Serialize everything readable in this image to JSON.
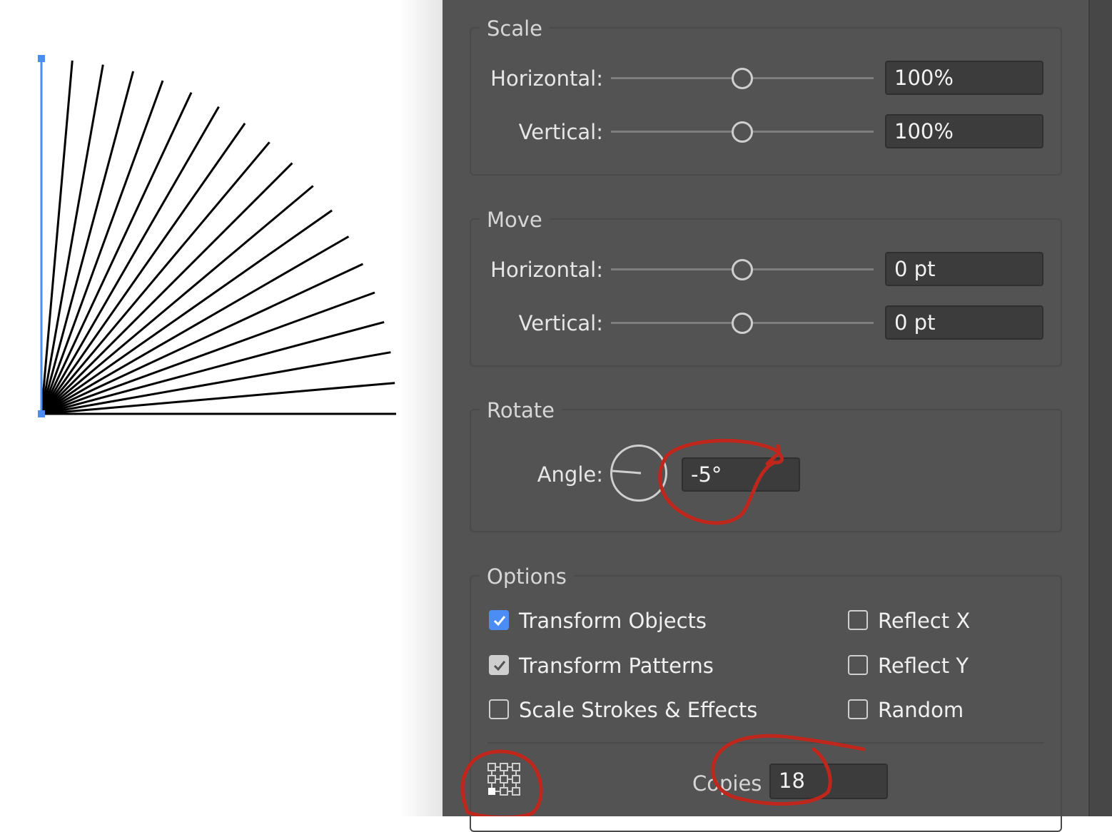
{
  "canvas": {
    "ray_count": 19,
    "ray_step_deg": 5,
    "line_color": "#000000",
    "selection_color": "#4b8cf5"
  },
  "scale": {
    "title": "Scale",
    "horizontal_label": "Horizontal:",
    "horizontal_value": "100%",
    "vertical_label": "Vertical:",
    "vertical_value": "100%"
  },
  "move": {
    "title": "Move",
    "horizontal_label": "Horizontal:",
    "horizontal_value": "0 pt",
    "vertical_label": "Vertical:",
    "vertical_value": "0 pt"
  },
  "rotate": {
    "title": "Rotate",
    "angle_label": "Angle:",
    "angle_value": "-5°"
  },
  "options": {
    "title": "Options",
    "transform_objects": "Transform Objects",
    "transform_patterns": "Transform Patterns",
    "scale_strokes": "Scale Strokes & Effects",
    "reflect_x": "Reflect X",
    "reflect_y": "Reflect Y",
    "random": "Random",
    "copies_label": "Copies",
    "copies_value": "18"
  },
  "icons": {
    "reference_point": "reference-point-grid-icon",
    "angle_dial": "angle-dial-icon"
  },
  "colors": {
    "panel_bg": "#535353",
    "field_bg": "#3c3c3c",
    "checkbox_blue": "#4b8cf5",
    "annotation_red": "#c0271c"
  }
}
